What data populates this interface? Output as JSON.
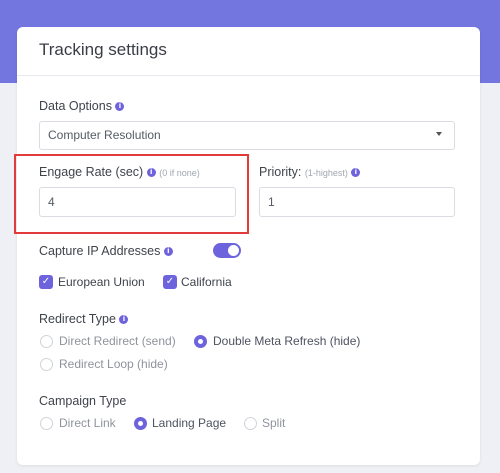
{
  "title": "Tracking settings",
  "data_options": {
    "label": "Data Options",
    "value": "Computer Resolution"
  },
  "engage_rate": {
    "label": "Engage Rate (sec)",
    "hint": "(0 if none)",
    "value": "4"
  },
  "priority": {
    "label": "Priority:",
    "hint": "(1-highest)",
    "value": "1"
  },
  "capture_ip": {
    "label": "Capture IP Addresses",
    "enabled": true
  },
  "regions": [
    {
      "label": "European Union",
      "checked": true
    },
    {
      "label": "California",
      "checked": true
    }
  ],
  "redirect_type": {
    "label": "Redirect Type",
    "options": [
      "Direct Redirect (send)",
      "Double Meta Refresh (hide)",
      "Redirect Loop (hide)"
    ],
    "selected": "Double Meta Refresh (hide)"
  },
  "campaign_type": {
    "label": "Campaign Type",
    "options": [
      "Direct Link",
      "Landing Page",
      "Split"
    ],
    "selected": "Landing Page"
  },
  "icons": {
    "info": "info-icon",
    "caret": "caret-down-icon",
    "check": "checkmark-icon"
  },
  "colors": {
    "accent": "#6c63dd",
    "header_band": "#7476e0",
    "highlight": "#e23b3b"
  }
}
